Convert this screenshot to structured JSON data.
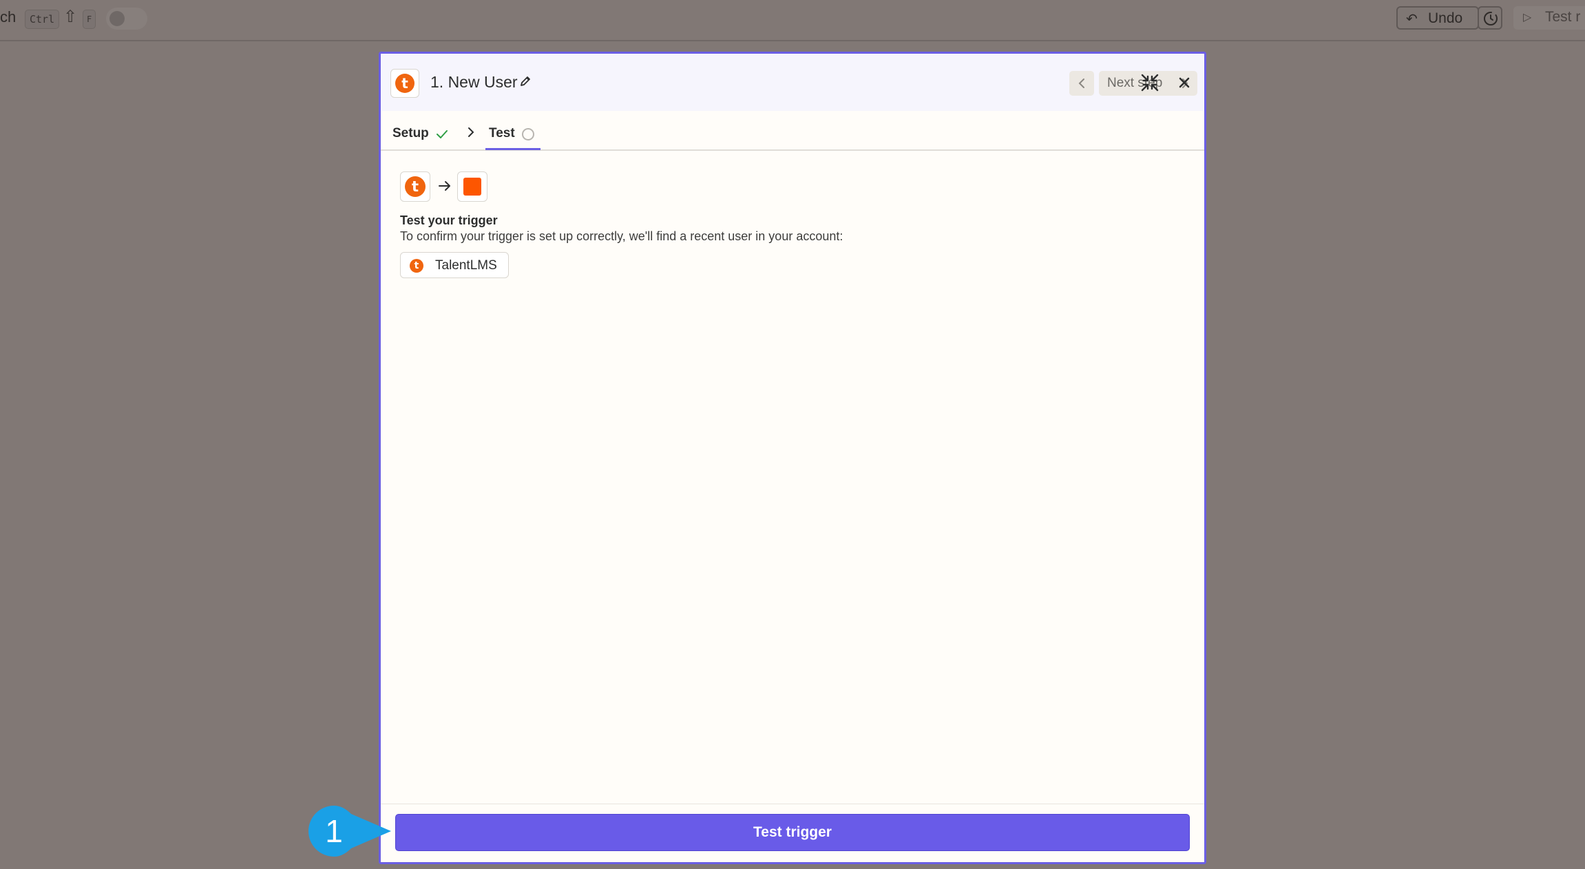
{
  "toolbar": {
    "search_fragment": "ch",
    "shortcut": {
      "key1": "Ctrl",
      "key2": "⇧",
      "key3": "F"
    },
    "undo_label": "Undo",
    "test_run_label": "Test r"
  },
  "modal": {
    "title": "1. New User",
    "next_step_label": "Next step",
    "tabs": [
      {
        "label": "Setup",
        "status": "complete"
      },
      {
        "label": "Test",
        "status": "pending"
      }
    ],
    "section_title": "Test your trigger",
    "section_description": "To confirm your trigger is set up correctly, we'll find a recent user in your account:",
    "app_chip_label": "TalentLMS",
    "app_logo_letter": "t",
    "primary_button_label": "Test trigger"
  },
  "step_marker": {
    "number": "1"
  },
  "colors": {
    "accent": "#695be8",
    "brand_orange": "#f0650f",
    "square_orange": "#fd5600",
    "overlay": "#817875",
    "success_green": "#2f9e44",
    "marker_blue": "#1aa0e6"
  },
  "icons": [
    "undo-icon",
    "history-icon",
    "play-icon",
    "pencil-icon",
    "chevron-left-icon",
    "chevron-right-icon",
    "collapse-icon",
    "close-icon",
    "check-icon",
    "pending-circle-icon",
    "arrow-right-icon"
  ]
}
